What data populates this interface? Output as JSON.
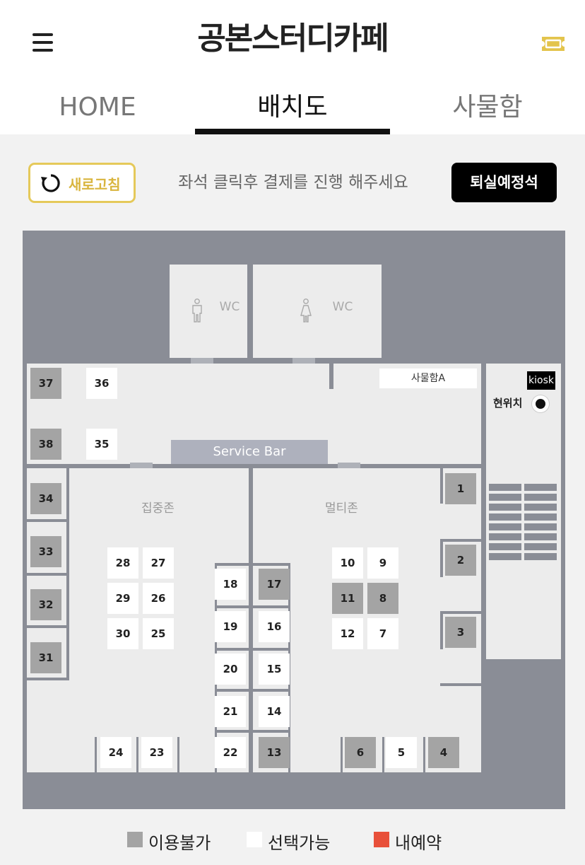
{
  "header": {
    "title": "공본스터디카페",
    "menu_icon": "hamburger-menu-icon",
    "ticket_icon": "ticket-icon"
  },
  "tabs": [
    {
      "label": "HOME"
    },
    {
      "label": "배치도"
    },
    {
      "label": "사물함"
    }
  ],
  "toolbar": {
    "refresh_label": "새로고침",
    "instruction": "좌석 클릭후 결제를 진행 해주세요",
    "checkout_label": "퇴실예정석"
  },
  "map": {
    "wc_label": "WC",
    "locker_label": "사물함A",
    "kiosk_label": "kiosk",
    "current_location_label": "현위치",
    "service_bar_label": "Service Bar",
    "zones": {
      "focus": "집중존",
      "multi": "멀티존"
    },
    "seats": [
      {
        "num": "1",
        "status": "unavailable"
      },
      {
        "num": "2",
        "status": "unavailable"
      },
      {
        "num": "3",
        "status": "unavailable"
      },
      {
        "num": "4",
        "status": "unavailable"
      },
      {
        "num": "5",
        "status": "available"
      },
      {
        "num": "6",
        "status": "unavailable"
      },
      {
        "num": "7",
        "status": "available"
      },
      {
        "num": "8",
        "status": "unavailable"
      },
      {
        "num": "9",
        "status": "available"
      },
      {
        "num": "10",
        "status": "available"
      },
      {
        "num": "11",
        "status": "unavailable"
      },
      {
        "num": "12",
        "status": "available"
      },
      {
        "num": "13",
        "status": "unavailable"
      },
      {
        "num": "14",
        "status": "available"
      },
      {
        "num": "15",
        "status": "available"
      },
      {
        "num": "16",
        "status": "available"
      },
      {
        "num": "17",
        "status": "unavailable"
      },
      {
        "num": "18",
        "status": "available"
      },
      {
        "num": "19",
        "status": "available"
      },
      {
        "num": "20",
        "status": "available"
      },
      {
        "num": "21",
        "status": "available"
      },
      {
        "num": "22",
        "status": "available"
      },
      {
        "num": "23",
        "status": "available"
      },
      {
        "num": "24",
        "status": "available"
      },
      {
        "num": "25",
        "status": "available"
      },
      {
        "num": "26",
        "status": "available"
      },
      {
        "num": "27",
        "status": "available"
      },
      {
        "num": "28",
        "status": "available"
      },
      {
        "num": "29",
        "status": "available"
      },
      {
        "num": "30",
        "status": "available"
      },
      {
        "num": "31",
        "status": "unavailable"
      },
      {
        "num": "32",
        "status": "unavailable"
      },
      {
        "num": "33",
        "status": "unavailable"
      },
      {
        "num": "34",
        "status": "unavailable"
      },
      {
        "num": "35",
        "status": "available"
      },
      {
        "num": "36",
        "status": "available"
      },
      {
        "num": "37",
        "status": "unavailable"
      },
      {
        "num": "38",
        "status": "unavailable"
      }
    ]
  },
  "legend": [
    {
      "label": "이용불가",
      "color": "#a4a4a4"
    },
    {
      "label": "선택가능",
      "color": "#ffffff"
    },
    {
      "label": "내예약",
      "color": "#e8503a"
    }
  ],
  "colors": {
    "accent": "#e5c95a",
    "unavailable": "#a4a4a4",
    "available": "#ffffff",
    "my_reservation": "#e8503a"
  }
}
